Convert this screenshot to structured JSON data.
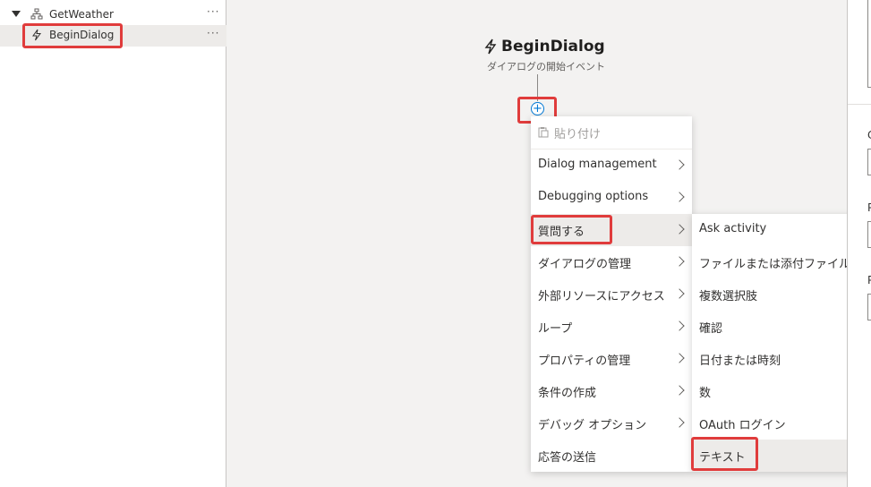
{
  "tree": {
    "dialog_label": "GetWeather",
    "trigger_label": "BeginDialog",
    "more": "···"
  },
  "node": {
    "title": "BeginDialog",
    "subtitle": "ダイアログの開始イベント",
    "add_symbol": "+"
  },
  "main_menu": {
    "paste": "貼り付け",
    "items": [
      "Dialog management",
      "Debugging options",
      "質問する",
      "ダイアログの管理",
      "外部リソースにアクセス",
      "ループ",
      "プロパティの管理",
      "条件の作成",
      "デバッグ オプション",
      "応答の送信"
    ]
  },
  "sub_menu": {
    "items": [
      "Ask activity",
      "ファイルまたは添付ファイル",
      "複数選択肢",
      "確認",
      "日付または時刻",
      "数",
      "OAuth ログイン",
      "テキスト"
    ]
  },
  "right_panel": {
    "letters": [
      "C",
      "P",
      "P"
    ]
  },
  "colors": {
    "highlight": "#e03c3c",
    "accent": "#0078d4"
  }
}
